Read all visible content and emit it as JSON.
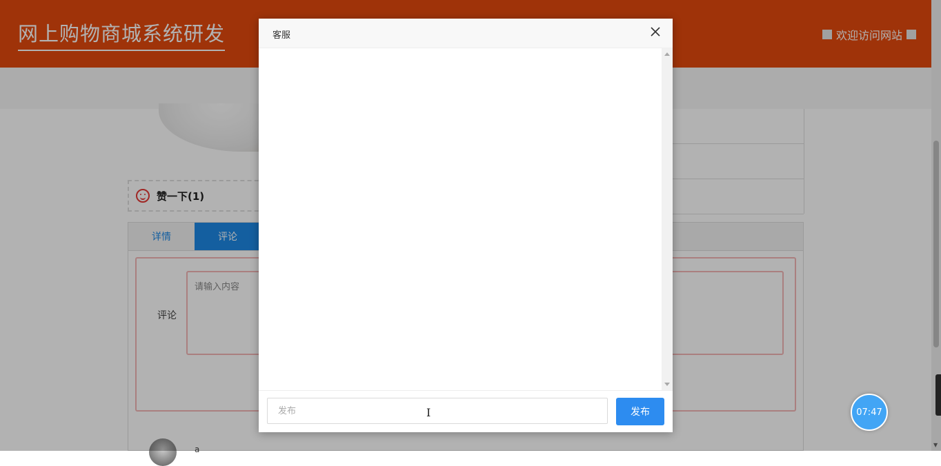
{
  "header": {
    "site_title": "网上购物商城系统研发",
    "welcome_text": "欢迎访问网站"
  },
  "product": {
    "like_label": "赞一下(1)"
  },
  "tabs": [
    {
      "label": "详情"
    },
    {
      "label": "评论"
    }
  ],
  "comment_form": {
    "label": "评论",
    "placeholder": "请输入内容"
  },
  "comment_list": {
    "first_user": "a"
  },
  "clock": {
    "time": "07:47"
  },
  "modal": {
    "title": "客服",
    "close_icon": "close-icon",
    "input_placeholder": "发布",
    "send_label": "发布"
  },
  "colors": {
    "header_bg": "#e44a0d",
    "accent": "#1e88e5",
    "send_button": "#2d8cf0"
  }
}
